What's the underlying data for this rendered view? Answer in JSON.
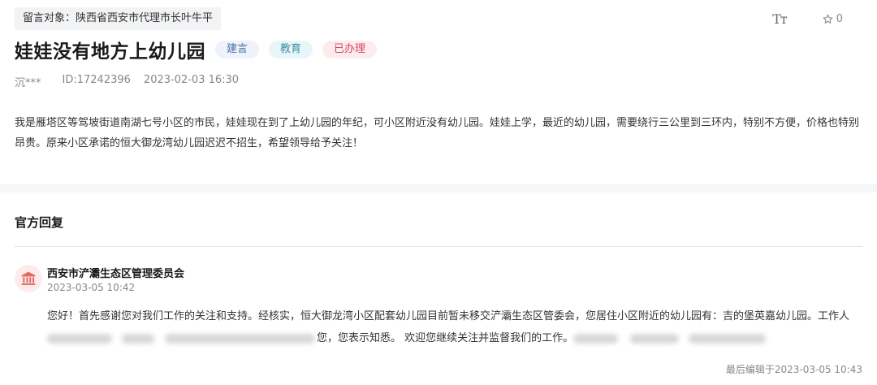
{
  "recipient": "留言对象：陕西省西安市代理市长叶牛平",
  "toolbar": {
    "font_icon": "Tт",
    "favorite_count": "0"
  },
  "title": "娃娃没有地方上幼儿园",
  "tags": [
    {
      "label": "建言",
      "color": "#4b6fa8"
    },
    {
      "label": "教育",
      "color": "#3e8ea3"
    },
    {
      "label": "已办理",
      "color": "#d9485f"
    }
  ],
  "meta": {
    "author": "沉***",
    "id": "ID:17242396",
    "datetime": "2023-02-03 16:30"
  },
  "content": "我是雁塔区等驾坡街道南湖七号小区的市民，娃娃现在到了上幼儿园的年纪，可小区附近没有幼儿园。娃娃上学，最近的幼儿园，需要绕行三公里到三环内，特别不方便，价格也特别昂贵。原来小区承诺的恒大御龙湾幼儿园迟迟不招生，希望领导给予关注！",
  "reply": {
    "heading": "官方回复",
    "org_name": "西安市浐灞生态区管理委员会",
    "org_date": "2023-03-05 10:42",
    "body_line1": "您好！首先感谢您对我们工作的关注和支持。经核实，恒大御龙湾小区配套幼儿园目前暂未移交浐灞生态区管委会，您居住小区附近的幼儿园有：吉的堡英嘉幼儿园。工作人",
    "body_line2_a": "您，您表示知悉。 欢迎您继续关注并监督我们的工作。",
    "edited": "最后编辑于2023-03-05 10:43"
  }
}
